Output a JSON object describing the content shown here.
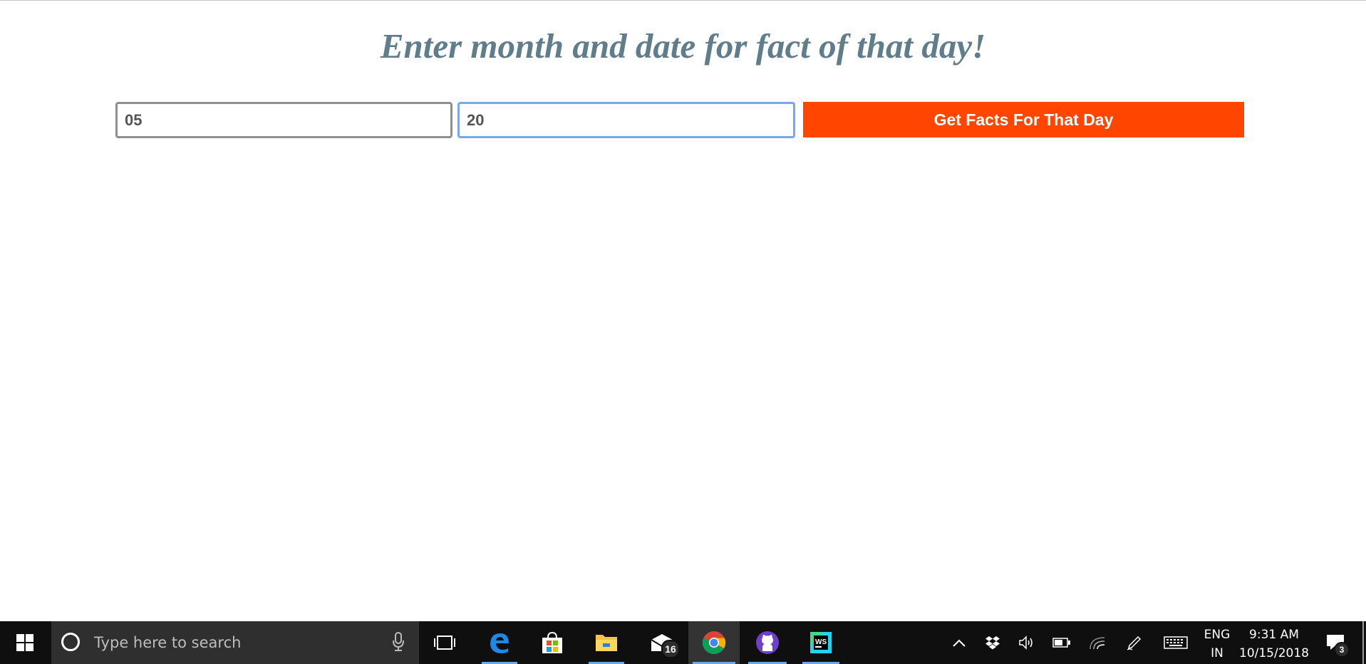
{
  "page": {
    "heading": "Enter month and date for fact of that day!",
    "month_value": "05",
    "day_value": "20",
    "submit_label": "Get Facts For That Day",
    "accent_color": "#ff4500",
    "heading_color": "#607d8b"
  },
  "taskbar": {
    "search_placeholder": "Type here to search",
    "mail_badge": "16",
    "language_top": "ENG",
    "language_bottom": "IN",
    "time": "9:31 AM",
    "date": "10/15/2018",
    "notification_count": "3",
    "apps": [
      "edge-icon",
      "store-icon",
      "file-explorer-icon",
      "mail-icon",
      "chrome-icon",
      "github-icon",
      "webstorm-icon"
    ]
  }
}
